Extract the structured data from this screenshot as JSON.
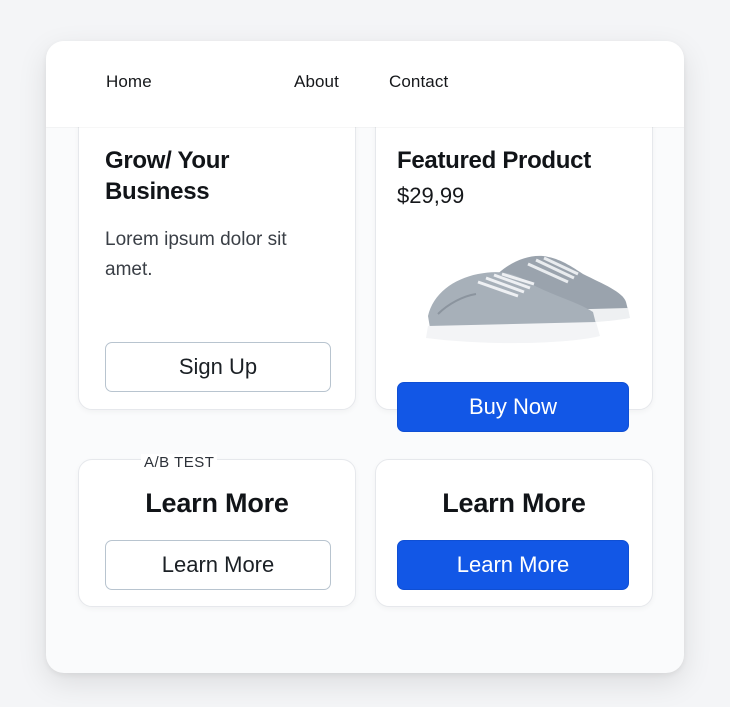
{
  "nav": {
    "home": "Home",
    "about": "About",
    "contact": "Contact"
  },
  "hero_card": {
    "title": "Grow/ Your Business",
    "body": "Lorem ipsum dolor sit amet.",
    "button": "Sign Up"
  },
  "product_card": {
    "title": "Featured Product",
    "price": "$29,99",
    "image": "gray-sneakers",
    "button": "Buy Now"
  },
  "variant_a": {
    "tag": "A/B TEST",
    "title": "Learn More",
    "button": "Learn More"
  },
  "variant_b": {
    "title": "Learn More",
    "button": "Learn More"
  },
  "colors": {
    "primary": "#1257e6",
    "outline": "#b8c4cf",
    "text": "#111418"
  }
}
